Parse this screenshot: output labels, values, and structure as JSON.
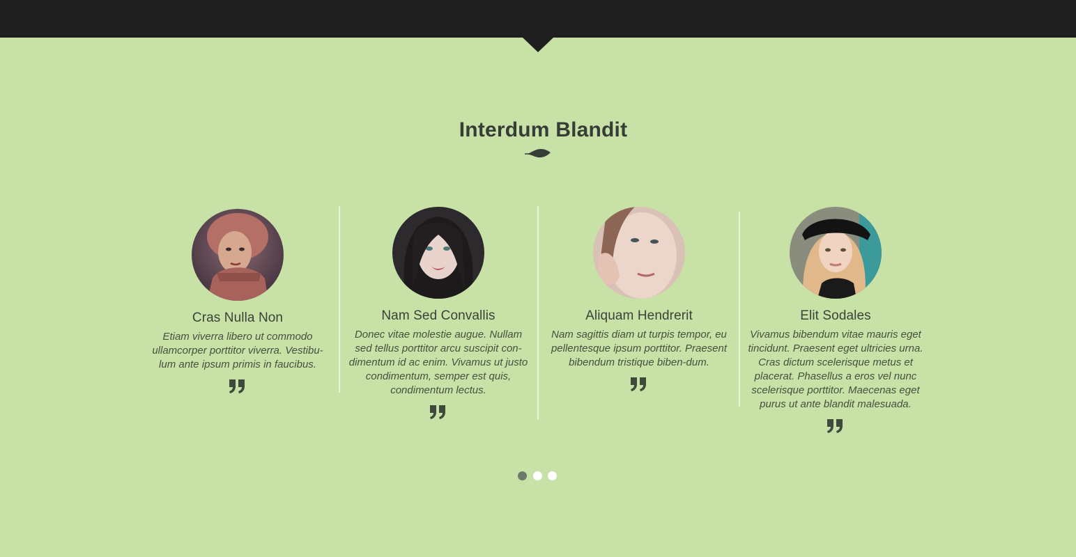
{
  "section": {
    "title": "Interdum Blandit"
  },
  "testimonials": [
    {
      "name": "Cras Nulla Non",
      "text": "Etiam viverra libero ut commodo ullamcorper porttitor viverra. Vestibu-lum ante ipsum primis in faucibus."
    },
    {
      "name": "Nam Sed Convallis",
      "text": "Donec vitae molestie augue. Nullam sed tellus porttitor arcu suscipit con-dimentum id ac enim. Vivamus ut justo condimentum, semper est quis, condimentum lectus."
    },
    {
      "name": "Aliquam Hendrerit",
      "text": "Nam sagittis diam ut turpis tempor, eu pellentesque ipsum porttitor. Praesent bibendum tristique biben-dum."
    },
    {
      "name": "Elit Sodales",
      "text": "Vivamus bibendum vitae mauris eget tincidunt. Praesent eget ultricies urna. Cras dictum scelerisque metus et placerat. Phasellus a eros vel nunc scelerisque porttitor. Maecenas eget purus ut ante blandit malesuada."
    }
  ],
  "pagination": {
    "active_index": 0,
    "count": 3
  },
  "colors": {
    "background": "#c7e1a6",
    "topbar": "#1f1f1f",
    "heading": "#363d37",
    "dot_active": "#6b7a6a",
    "dot_inactive": "#ffffff"
  },
  "icons": {
    "leaf": "leaf-icon",
    "quote": "quote-icon"
  }
}
